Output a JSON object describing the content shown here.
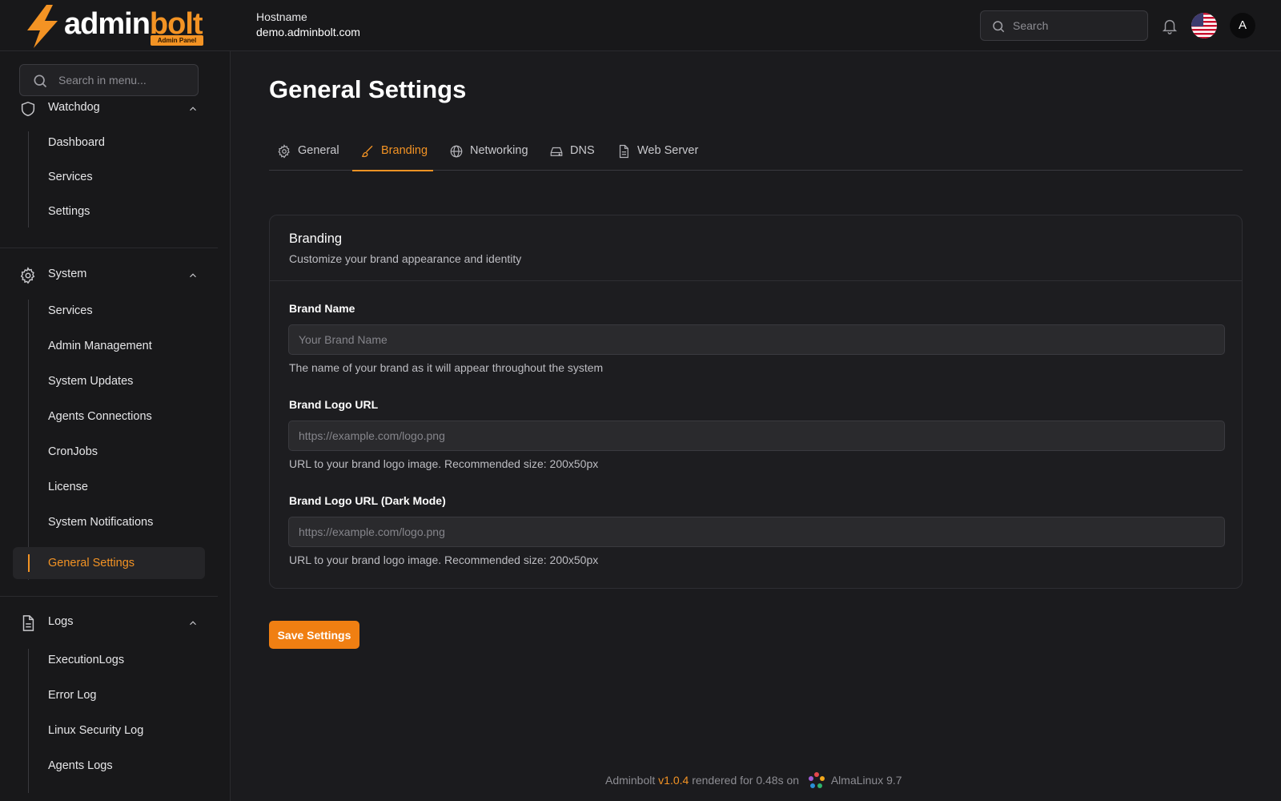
{
  "brand": {
    "name_main": "admin",
    "name_accent": "bolt",
    "badge": "Admin Panel"
  },
  "header": {
    "host_label": "Hostname",
    "host_value": "demo.adminbolt.com",
    "search_placeholder": "Search",
    "avatar_initial": "A",
    "accent_color": "#f39324"
  },
  "sidebar": {
    "search_placeholder": "Search in menu...",
    "groups": [
      {
        "label": "Watchdog",
        "icon": "shield-icon",
        "items": [
          "Dashboard",
          "Services",
          "Settings"
        ]
      },
      {
        "label": "System",
        "icon": "gear-icon",
        "items": [
          "Services",
          "Admin Management",
          "System Updates",
          "Agents Connections",
          "CronJobs",
          "License",
          "System Notifications",
          "General Settings"
        ]
      },
      {
        "label": "Logs",
        "icon": "document-icon",
        "items": [
          "ExecutionLogs",
          "Error Log",
          "Linux Security Log",
          "Agents Logs"
        ]
      }
    ],
    "active_item": "General Settings"
  },
  "main": {
    "title": "General Settings",
    "tabs": [
      {
        "label": "General",
        "icon": "gear-icon"
      },
      {
        "label": "Branding",
        "icon": "brush-icon"
      },
      {
        "label": "Networking",
        "icon": "globe-icon"
      },
      {
        "label": "DNS",
        "icon": "server-icon"
      },
      {
        "label": "Web Server",
        "icon": "document-icon"
      }
    ],
    "active_tab": "Branding",
    "card": {
      "title": "Branding",
      "subtitle": "Customize your brand appearance and identity",
      "fields": [
        {
          "label": "Brand Name",
          "placeholder": "Your Brand Name",
          "value": "",
          "help": "The name of your brand as it will appear throughout the system"
        },
        {
          "label": "Brand Logo URL",
          "placeholder": "https://example.com/logo.png",
          "value": "",
          "help": "URL to your brand logo image. Recommended size: 200x50px"
        },
        {
          "label": "Brand Logo URL (Dark Mode)",
          "placeholder": "https://example.com/logo.png",
          "value": "",
          "help": "URL to your brand logo image. Recommended size: 200x50px"
        }
      ]
    },
    "save_label": "Save Settings"
  },
  "footer": {
    "product": "Adminbolt",
    "version": "v1.0.4",
    "rendered": "rendered for 0.48s on",
    "os": "AlmaLinux 9.7"
  }
}
